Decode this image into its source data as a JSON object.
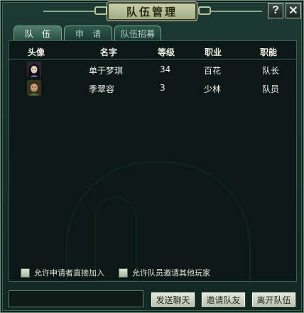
{
  "window": {
    "title": "队伍管理",
    "help_label": "?",
    "close_label": "✕"
  },
  "tabs": [
    {
      "label": "队伍",
      "active": true
    },
    {
      "label": "申请",
      "active": false
    },
    {
      "label": "队伍招募",
      "active": false
    }
  ],
  "table": {
    "headers": [
      "头像",
      "名字",
      "等级",
      "职业",
      "职能"
    ],
    "rows": [
      {
        "avatar": "female-character-portrait",
        "name": "单于梦琪",
        "level": "34",
        "job": "百花",
        "role": "队长"
      },
      {
        "avatar": "male-character-portrait",
        "name": "季翠容",
        "level": "3",
        "job": "少林",
        "role": "队员"
      }
    ]
  },
  "options": {
    "allow_direct_join": "允许申请者直接加入",
    "allow_member_invite": "允许队员邀请其他玩家"
  },
  "chat_input": {
    "value": ""
  },
  "buttons": {
    "send_chat": "发送聊天",
    "invite_team": "邀请队友",
    "leave_team": "离开队伍"
  },
  "colors": {
    "frame": "#1d3a33",
    "panel": "#0c1815",
    "button": "#d6dcc8"
  }
}
